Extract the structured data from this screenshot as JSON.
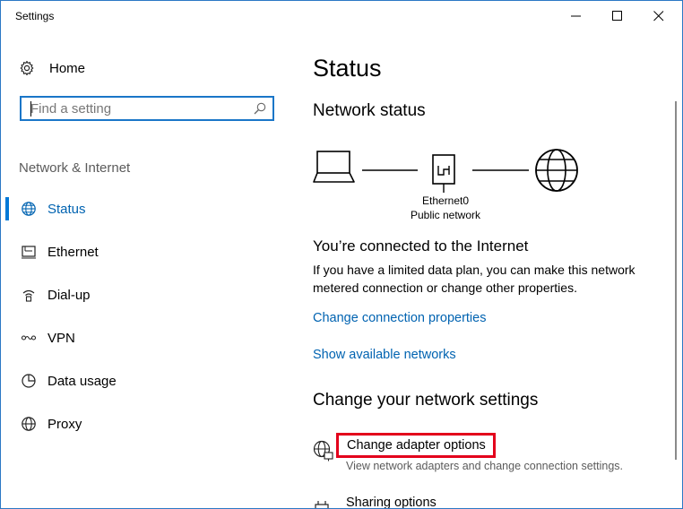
{
  "window": {
    "title": "Settings",
    "controls": {
      "minimize": "minimize-icon",
      "maximize": "maximize-icon",
      "close": "close-icon"
    }
  },
  "sidebar": {
    "home_label": "Home",
    "search": {
      "placeholder": "Find a setting",
      "value": ""
    },
    "section_title": "Network & Internet",
    "items": [
      {
        "label": "Status",
        "icon": "globe-icon",
        "active": true
      },
      {
        "label": "Ethernet",
        "icon": "ethernet-icon",
        "active": false
      },
      {
        "label": "Dial-up",
        "icon": "dialup-icon",
        "active": false
      },
      {
        "label": "VPN",
        "icon": "vpn-icon",
        "active": false
      },
      {
        "label": "Data usage",
        "icon": "data-usage-icon",
        "active": false
      },
      {
        "label": "Proxy",
        "icon": "proxy-globe-icon",
        "active": false
      }
    ]
  },
  "main": {
    "title": "Status",
    "network_status_heading": "Network status",
    "diagram": {
      "adapter_name": "Ethernet0",
      "network_type": "Public network"
    },
    "connected_heading": "You’re connected to the Internet",
    "connected_desc": "If you have a limited data plan, you can make this network metered connection or change other properties.",
    "links": {
      "change_connection_properties": "Change connection properties",
      "show_available_networks": "Show available networks"
    },
    "change_settings_heading": "Change your network settings",
    "adapter_options": {
      "title": "Change adapter options",
      "subtitle": "View network adapters and change connection settings."
    },
    "sharing_options": {
      "title": "Sharing options"
    }
  },
  "colors": {
    "accent": "#0078d7",
    "link": "#0063b1",
    "highlight_box": "#e3001b",
    "window_border": "#2b78c5"
  }
}
